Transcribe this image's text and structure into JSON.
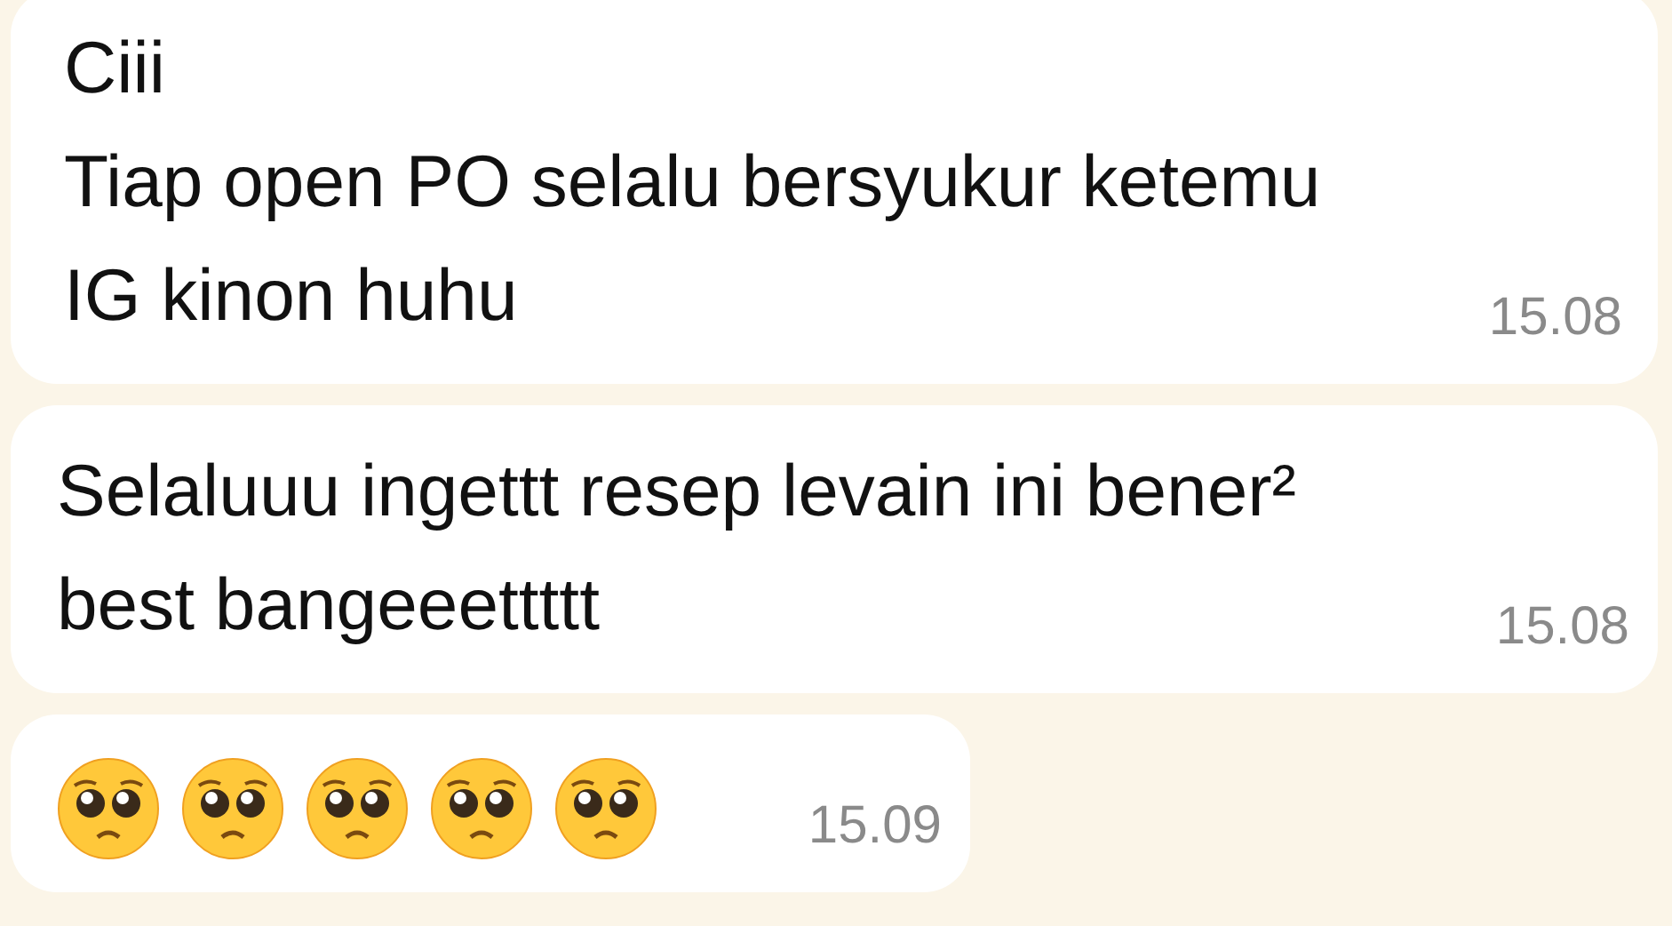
{
  "messages": [
    {
      "kind": "text",
      "lines": [
        "Ciii",
        "Tiap open PO selalu bersyukur ketemu",
        "IG kinon huhu"
      ],
      "time": "15.08"
    },
    {
      "kind": "text",
      "lines": [
        "Selaluuu ingettt resep levain ini bener²",
        "best bangeeettttt"
      ],
      "time": "15.08"
    },
    {
      "kind": "emoji",
      "emojis": [
        {
          "kind": "pleading"
        },
        {
          "kind": "pleading"
        },
        {
          "kind": "pleading"
        },
        {
          "kind": "pleading"
        },
        {
          "kind": "pleading"
        }
      ],
      "time": "15.09"
    }
  ]
}
